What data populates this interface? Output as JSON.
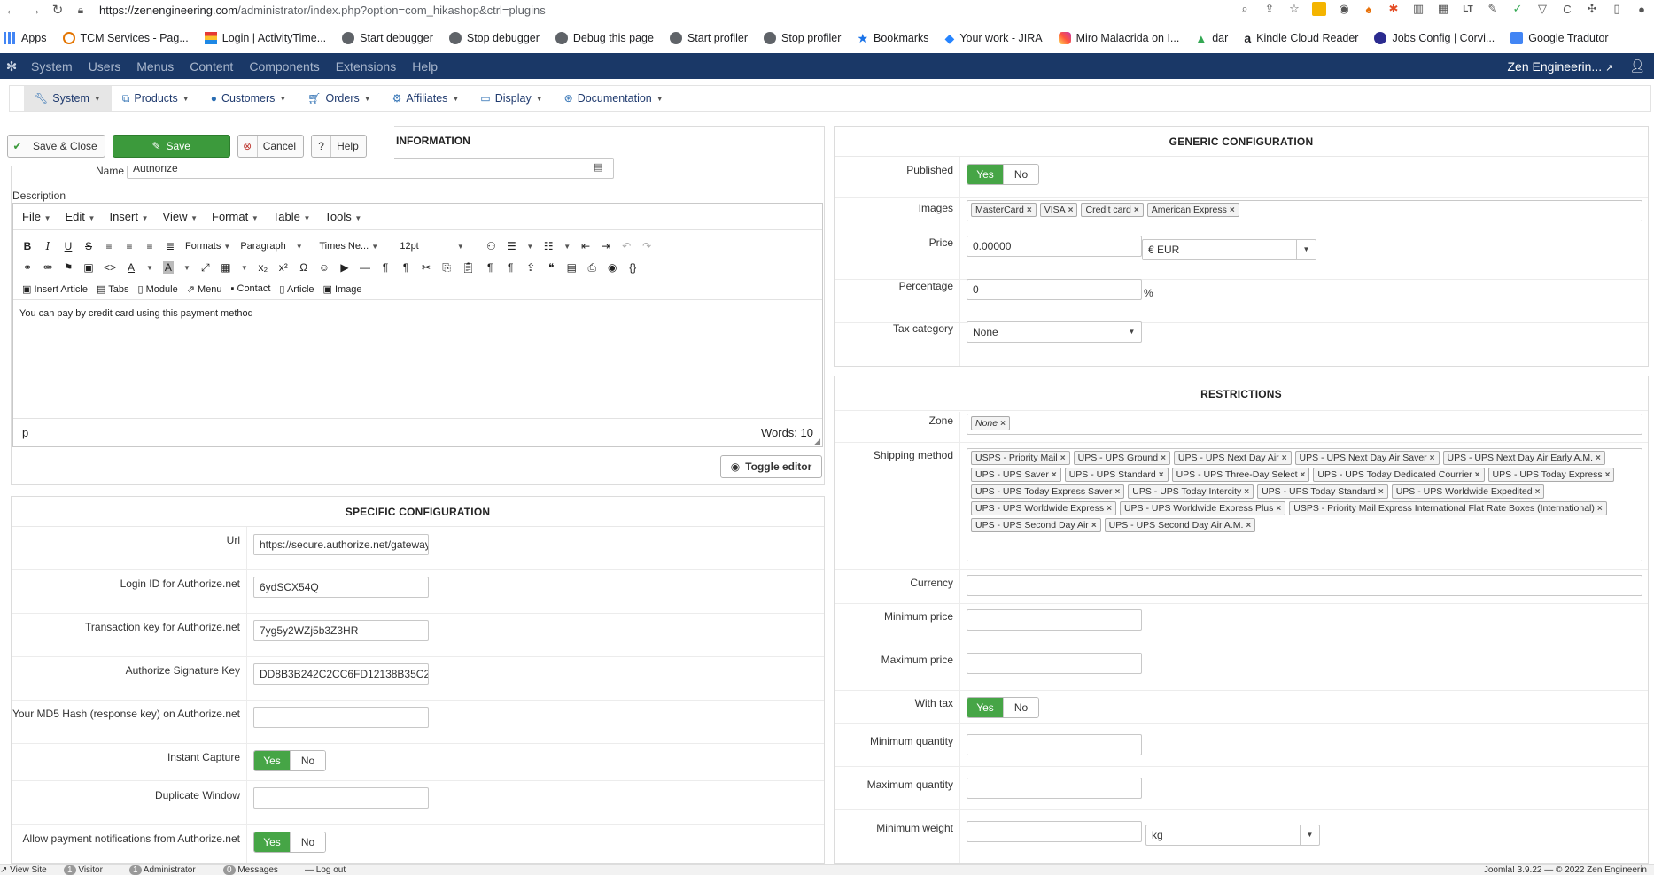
{
  "browser": {
    "url_host": "https://zenengineering.com",
    "url_path": "/administrator/index.php?option=com_hikashop&ctrl=plugins",
    "bookmarks": [
      "Apps",
      "TCM Services - Pag...",
      "Login | ActivityTime...",
      "Start debugger",
      "Stop debugger",
      "Debug this page",
      "Start profiler",
      "Stop profiler",
      "Bookmarks",
      "Your work - JIRA",
      "Miro Malacrida on I...",
      "dar",
      "Kindle Cloud Reader",
      "Jobs Config | Corvi...",
      "Google Tradutor"
    ]
  },
  "topbar": {
    "menu": [
      "System",
      "Users",
      "Menus",
      "Content",
      "Components",
      "Extensions",
      "Help"
    ],
    "site_name": "Zen Engineerin..."
  },
  "subnav": [
    {
      "label": "System",
      "icon": "wrench-icon"
    },
    {
      "label": "Products",
      "icon": "cubes-icon"
    },
    {
      "label": "Customers",
      "icon": "user-icon"
    },
    {
      "label": "Orders",
      "icon": "cart-icon"
    },
    {
      "label": "Affiliates",
      "icon": "gears-icon"
    },
    {
      "label": "Display",
      "icon": "monitor-icon"
    },
    {
      "label": "Documentation",
      "icon": "lifebuoy-icon"
    }
  ],
  "toolbar": {
    "save_close": "Save & Close",
    "save": "Save",
    "cancel": "Cancel",
    "help": "Help"
  },
  "information": {
    "title": "INFORMATION",
    "name_label": "Name",
    "name_value": "Authorize",
    "description_label": "Description"
  },
  "editor": {
    "menus": [
      "File",
      "Edit",
      "Insert",
      "View",
      "Format",
      "Table",
      "Tools"
    ],
    "formats": "Formats",
    "paragraph": "Paragraph",
    "font": "Times Ne...",
    "size": "12pt",
    "inserts": [
      "Insert Article",
      "Tabs",
      "Module",
      "Menu",
      "Contact",
      "Article",
      "Image"
    ],
    "content": "You can pay by credit card using this payment method",
    "path": "p",
    "words": "Words: 10",
    "toggle": "Toggle editor"
  },
  "specific": {
    "title": "SPECIFIC CONFIGURATION",
    "url_label": "Url",
    "url_value": "https://secure.authorize.net/gateway",
    "login_label": "Login ID for Authorize.net",
    "login_value": "6ydSCX54Q",
    "tkey_label": "Transaction key for Authorize.net",
    "tkey_value": "7yg5y2WZj5b3Z3HR",
    "sig_label": "Authorize Signature Key",
    "sig_value": "DD8B3B242C2CC6FD12138B35C2",
    "md5_label": "Your MD5 Hash (response key) on Authorize.net",
    "capture_label": "Instant Capture",
    "dup_label": "Duplicate Window",
    "notify_label": "Allow payment notifications from Authorize.net",
    "yes": "Yes",
    "no": "No"
  },
  "generic": {
    "title": "GENERIC CONFIGURATION",
    "published_label": "Published",
    "images_label": "Images",
    "images": [
      "MasterCard",
      "VISA",
      "Credit card",
      "American Express"
    ],
    "price_label": "Price",
    "price_value": "0.00000",
    "currency_value": "€ EUR",
    "percentage_label": "Percentage",
    "percentage_value": "0",
    "percent_sign": "%",
    "tax_label": "Tax category",
    "tax_value": "None"
  },
  "restrictions": {
    "title": "RESTRICTIONS",
    "zone_label": "Zone",
    "zone_value": "None",
    "shipping_label": "Shipping method",
    "shipping": [
      "USPS - Priority Mail",
      "UPS - UPS Ground",
      "UPS - UPS Next Day Air",
      "UPS - UPS Next Day Air Saver",
      "UPS - UPS Next Day Air Early A.M.",
      "UPS - UPS Saver",
      "UPS - UPS Standard",
      "UPS - UPS Three-Day Select",
      "UPS - UPS Today Dedicated Courrier",
      "UPS - UPS Today Express",
      "UPS - UPS Today Express Saver",
      "UPS - UPS Today Intercity",
      "UPS - UPS Today Standard",
      "UPS - UPS Worldwide Expedited",
      "UPS - UPS Worldwide Express",
      "UPS - UPS Worldwide Express Plus",
      "USPS - Priority Mail Express International Flat Rate Boxes (International)",
      "UPS - UPS Second Day Air",
      "UPS - UPS Second Day Air A.M."
    ],
    "currency_label": "Currency",
    "minprice_label": "Minimum price",
    "maxprice_label": "Maximum price",
    "withtax_label": "With tax",
    "minqty_label": "Minimum quantity",
    "maxqty_label": "Maximum quantity",
    "minweight_label": "Minimum weight",
    "weight_unit": "kg"
  },
  "footer": {
    "view_site": "View Site",
    "visitor_count": "1",
    "visitor": "Visitor",
    "admin_count": "1",
    "admin": "Administrator",
    "msg_count": "0",
    "messages": "Messages",
    "logout": "Log out",
    "version": "Joomla! 3.9.22 — © 2022 Zen Engineerin"
  },
  "colors": {
    "topbar": "#1a3867",
    "accent_green": "#46a546",
    "link_blue": "#1f3a6e"
  }
}
